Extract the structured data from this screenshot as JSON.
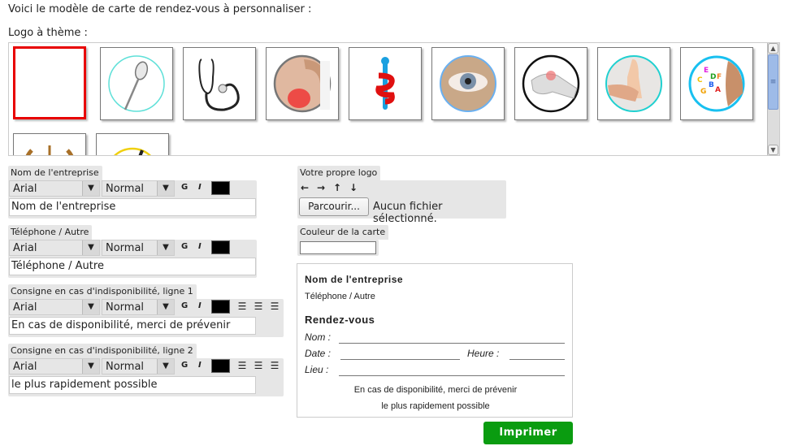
{
  "intro_text": "Voici le modèle de carte de rendez-vous à personnaliser :",
  "logo_section_label": "Logo à thème :",
  "logos": [
    {
      "name": "blank",
      "selected": true
    },
    {
      "name": "dental-mirror",
      "selected": false
    },
    {
      "name": "stethoscope",
      "selected": false
    },
    {
      "name": "back-pain",
      "selected": false
    },
    {
      "name": "caduceus",
      "selected": false
    },
    {
      "name": "eye",
      "selected": false
    },
    {
      "name": "wrist-pain",
      "selected": false
    },
    {
      "name": "foot-massage",
      "selected": false
    },
    {
      "name": "speech-therapy-letters",
      "selected": false
    },
    {
      "name": "laurel-emblem",
      "selected": false
    },
    {
      "name": "yellow-circle-tools",
      "selected": false
    }
  ],
  "field_groups": [
    {
      "label": "Nom de l'entreprise",
      "font": "Arial",
      "size": "Normal",
      "bold_label": "G",
      "italic_label": "I",
      "color": "#000000",
      "value": "Nom de l'entreprise",
      "has_align": false
    },
    {
      "label": "Téléphone / Autre",
      "font": "Arial",
      "size": "Normal",
      "bold_label": "G",
      "italic_label": "I",
      "color": "#000000",
      "value": "Téléphone / Autre",
      "has_align": false
    },
    {
      "label": "Consigne en cas d'indisponibilité, ligne 1",
      "font": "Arial",
      "size": "Normal",
      "bold_label": "G",
      "italic_label": "I",
      "color": "#000000",
      "value": "En cas de disponibilité, merci de prévenir",
      "has_align": true
    },
    {
      "label": "Consigne en cas d'indisponibilité, ligne 2",
      "font": "Arial",
      "size": "Normal",
      "bold_label": "G",
      "italic_label": "I",
      "color": "#000000",
      "value": "le plus rapidement possible",
      "has_align": true
    }
  ],
  "dropdown_arrow": "▼",
  "align_icons": {
    "left": "☰",
    "center": "☰",
    "right": "☰"
  },
  "own_logo": {
    "label": "Votre propre logo",
    "arrows": {
      "left": "←",
      "right": "→",
      "up": "↑",
      "down": "↓"
    },
    "browse_label": "Parcourir...",
    "no_file_text": "Aucun fichier sélectionné."
  },
  "card_color": {
    "label": "Couleur de la carte",
    "value": ""
  },
  "card_preview": {
    "company": "Nom de l'entreprise",
    "phone": "Téléphone / Autre",
    "title": "Rendez-vous",
    "name_label": "Nom :",
    "date_label": "Date :",
    "time_label": "Heure :",
    "place_label": "Lieu :",
    "message_line1": "En cas de disponibilité, merci de prévenir",
    "message_line2": "le plus rapidement possible"
  },
  "print_button": "Imprimer",
  "colors": {
    "accent_green": "#0a9c10",
    "selected_red": "#e80000",
    "panel_gray": "#e6e6e6",
    "scroll_thumb": "#9ebbe8"
  }
}
